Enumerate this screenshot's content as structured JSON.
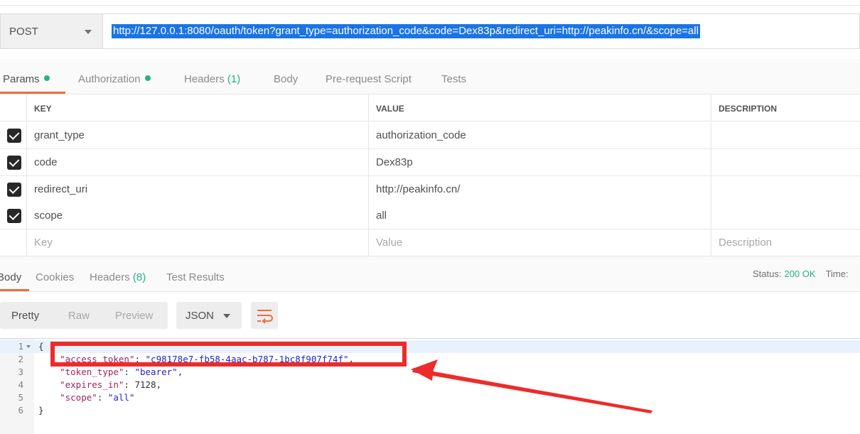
{
  "request": {
    "method": "POST",
    "url": "http://127.0.0.1:8080/oauth/token?grant_type=authorization_code&code=Dex83p&redirect_uri=http://peakinfo.cn/&scope=all"
  },
  "request_tabs": {
    "params": "Params",
    "authorization": "Authorization",
    "headers": "Headers",
    "headers_count": "(1)",
    "body": "Body",
    "prerequest": "Pre-request Script",
    "tests": "Tests"
  },
  "params": {
    "headers": {
      "key": "KEY",
      "value": "VALUE",
      "description": "DESCRIPTION"
    },
    "rows": [
      {
        "key": "grant_type",
        "value": "authorization_code",
        "checked": true
      },
      {
        "key": "code",
        "value": "Dex83p",
        "checked": true
      },
      {
        "key": "redirect_uri",
        "value": "http://peakinfo.cn/",
        "checked": true
      },
      {
        "key": "scope",
        "value": "all",
        "checked": true
      }
    ],
    "placeholder": {
      "key": "Key",
      "value": "Value",
      "description": "Description"
    }
  },
  "response_tabs": {
    "body": "Body",
    "cookies": "Cookies",
    "headers": "Headers",
    "headers_count": "(8)",
    "test_results": "Test Results"
  },
  "status": {
    "label": "Status:",
    "value": "200 OK",
    "time_label": "Time:"
  },
  "body_toolbar": {
    "pretty": "Pretty",
    "raw": "Raw",
    "preview": "Preview",
    "format": "JSON"
  },
  "editor": {
    "lines": [
      {
        "num": "1",
        "text": "{"
      },
      {
        "num": "2",
        "key": "\"access_token\"",
        "value": "\"c98178e7-fb58-4aac-b787-1bc8f907f74f\""
      },
      {
        "num": "3",
        "key": "\"token_type\"",
        "value": "\"bearer\""
      },
      {
        "num": "4",
        "key": "\"expires_in\"",
        "value": "7128"
      },
      {
        "num": "5",
        "key": "\"scope\"",
        "value": "\"all\""
      },
      {
        "num": "6",
        "text": "}"
      }
    ]
  },
  "colors": {
    "accent": "#f26b3a",
    "success": "#26b47f",
    "selection": "#1a74e8",
    "annotation": "#ee2b2b"
  }
}
